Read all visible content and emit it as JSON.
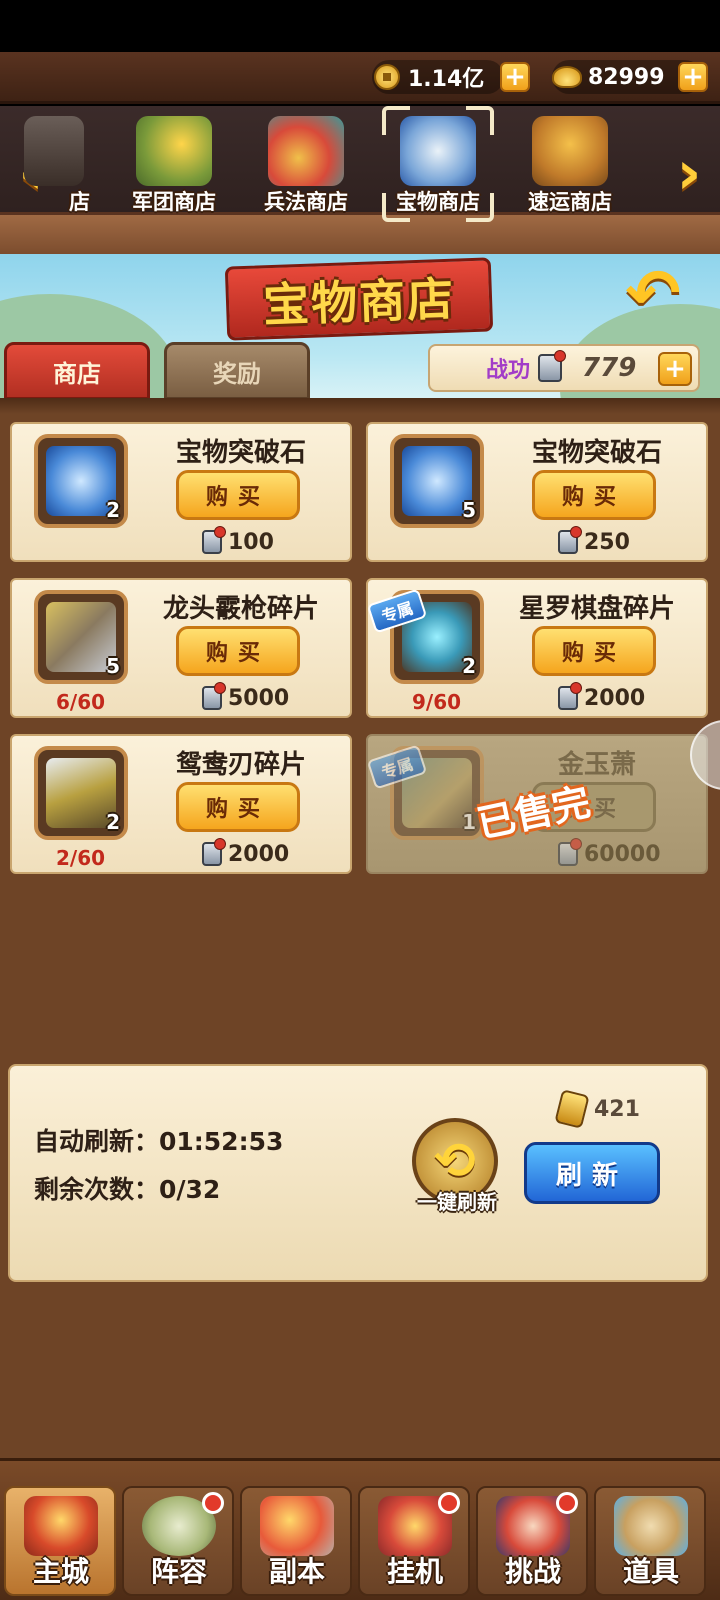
{
  "currency": {
    "coins": "1.14亿",
    "gold": "82999",
    "coin_icon": "copper-coin-icon",
    "gold_icon": "gold-ingot-icon"
  },
  "shop_tabs": [
    {
      "label": "店",
      "icon": "partial-shop-icon",
      "active": false
    },
    {
      "label": "军团商店",
      "icon": "legion-shop-icon",
      "active": false
    },
    {
      "label": "兵法商店",
      "icon": "tactics-shop-icon",
      "active": false
    },
    {
      "label": "宝物商店",
      "icon": "treasure-shop-icon",
      "active": true
    },
    {
      "label": "速运商店",
      "icon": "express-shop-icon",
      "active": false
    }
  ],
  "title": "宝物商店",
  "sub_tabs": {
    "shop": "商店",
    "reward": "奖励"
  },
  "merit": {
    "label": "战功",
    "value": "779"
  },
  "items": [
    {
      "name": "宝物突破石",
      "qty": "2",
      "buy": "购买",
      "price": "100",
      "progress": "",
      "exclusive": "",
      "sold_out": ""
    },
    {
      "name": "宝物突破石",
      "qty": "5",
      "buy": "购买",
      "price": "250",
      "progress": "",
      "exclusive": "",
      "sold_out": ""
    },
    {
      "name": "龙头霰枪碎片",
      "qty": "5",
      "buy": "购买",
      "price": "5000",
      "progress": "6/60",
      "exclusive": "",
      "sold_out": ""
    },
    {
      "name": "星罗棋盘碎片",
      "qty": "2",
      "buy": "购买",
      "price": "2000",
      "progress": "9/60",
      "exclusive": "专属",
      "sold_out": ""
    },
    {
      "name": "鸳鸯刃碎片",
      "qty": "2",
      "buy": "购买",
      "price": "2000",
      "progress": "2/60",
      "exclusive": "",
      "sold_out": ""
    },
    {
      "name": "金玉萧",
      "qty": "1",
      "buy": "购买",
      "price": "60000",
      "progress": "",
      "exclusive": "专属",
      "sold_out": "已售完"
    }
  ],
  "refresh": {
    "auto_label": "自动刷新：01:52:53",
    "remaining_label": "剩余次数：0/32",
    "one_key_label": "一键刷新",
    "cost": "421",
    "button": "刷新"
  },
  "nav": [
    {
      "label": "主城",
      "icon": "city-gate-icon",
      "active": true,
      "badge": false
    },
    {
      "label": "阵容",
      "icon": "formation-icon",
      "active": false,
      "badge": true
    },
    {
      "label": "副本",
      "icon": "dungeon-icon",
      "active": false,
      "badge": false
    },
    {
      "label": "挂机",
      "icon": "idle-bag-icon",
      "active": false,
      "badge": true
    },
    {
      "label": "挑战",
      "icon": "challenge-icon",
      "active": false,
      "badge": true
    },
    {
      "label": "道具",
      "icon": "items-bag-icon",
      "active": false,
      "badge": false
    }
  ]
}
